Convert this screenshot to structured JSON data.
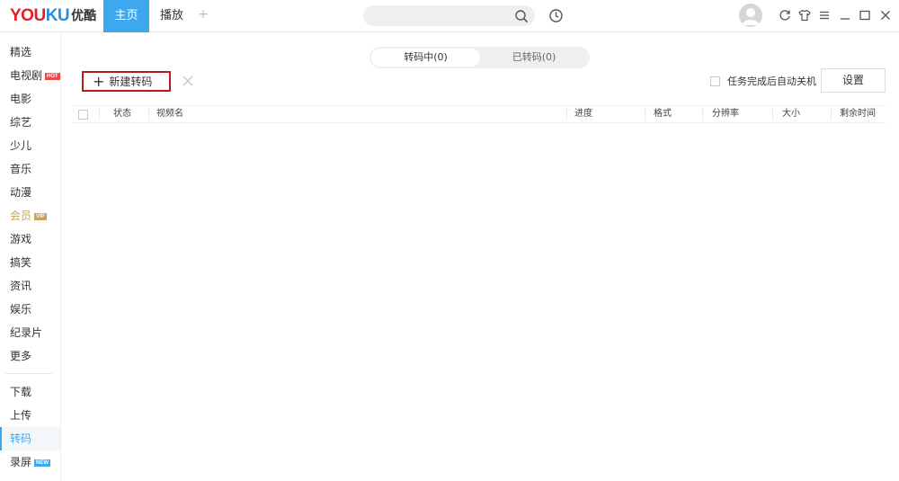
{
  "app": {
    "logo_en_1": "YOU",
    "logo_en_2": "KU",
    "logo_cn": "优酷"
  },
  "topbar": {
    "tabs": [
      {
        "label": "主页",
        "active": true
      },
      {
        "label": "播放",
        "active": false
      }
    ],
    "add_tab": "+",
    "search": {
      "value": "",
      "placeholder": ""
    }
  },
  "sidebar": {
    "items": [
      {
        "label": "精选"
      },
      {
        "label": "电视剧",
        "badge": "HOT"
      },
      {
        "label": "电影"
      },
      {
        "label": "综艺"
      },
      {
        "label": "少儿"
      },
      {
        "label": "音乐"
      },
      {
        "label": "动漫"
      },
      {
        "label": "会员",
        "badge": "VIP"
      },
      {
        "label": "游戏"
      },
      {
        "label": "搞笑"
      },
      {
        "label": "资讯"
      },
      {
        "label": "娱乐"
      },
      {
        "label": "纪录片"
      },
      {
        "label": "更多"
      }
    ],
    "bottom_items": [
      {
        "label": "下载"
      },
      {
        "label": "上传"
      },
      {
        "label": "转码",
        "active": true
      },
      {
        "label": "录屏",
        "badge": "NEW"
      }
    ]
  },
  "main": {
    "segment": {
      "converting": "转码中(0)",
      "converted": "已转码(0)"
    },
    "new_button": "新建转码",
    "new_button_plus": "+",
    "auto_shutdown": "任务完成后自动关机",
    "settings": "设置",
    "table_headers": {
      "status": "状态",
      "name": "视频名",
      "progress": "进度",
      "format": "格式",
      "resolution": "分辨率",
      "size": "大小",
      "remaining": "剩余时间"
    }
  },
  "colors": {
    "accent": "#3ea8ee",
    "highlight_border": "#b71c1c"
  }
}
